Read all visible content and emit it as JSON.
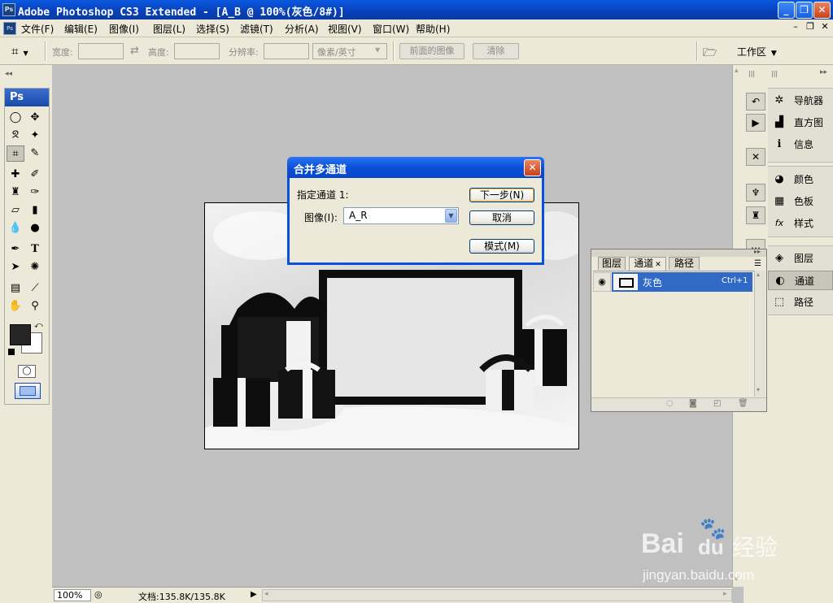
{
  "window": {
    "title": "Adobe Photoshop CS3 Extended - [A_B @ 100%(灰色/8#)]",
    "app_icon": "Ps",
    "controls": [
      "minimize-icon",
      "restore-icon",
      "close-icon"
    ]
  },
  "menubar": {
    "items": [
      "文件(F)",
      "编辑(E)",
      "图像(I)",
      "图层(L)",
      "选择(S)",
      "滤镜(T)",
      "分析(A)",
      "视图(V)",
      "窗口(W)",
      "帮助(H)"
    ]
  },
  "options": {
    "tool_icon": "crop-icon",
    "width_label": "宽度:",
    "height_label": "高度:",
    "resolution_label": "分辨率:",
    "unit_select": "像素/英寸",
    "front_image_button": "前面的图像",
    "clear_button": "清除",
    "workspace_label": "工作区",
    "width_value": "",
    "height_value": "",
    "resolution_value": ""
  },
  "toolbox": {
    "badge": "Ps"
  },
  "statusbar": {
    "zoom": "100%",
    "doc_info": "文档:135.8K/135.8K"
  },
  "dock": {
    "panels": [
      "导航器",
      "直方图",
      "信息",
      "颜色",
      "色板",
      "样式",
      "图层",
      "通道",
      "路径"
    ],
    "active_panel": "通道"
  },
  "channels_panel": {
    "tabs": [
      "图层",
      "通道",
      "路径"
    ],
    "active_tab": "通道",
    "row": {
      "name": "灰色",
      "shortcut": "Ctrl+1"
    }
  },
  "dialog": {
    "title": "合并多通道",
    "specify_label": "指定通道 1:",
    "image_label": "图像(I):",
    "image_value": "A_R",
    "buttons": {
      "next": "下一步(N)",
      "cancel": "取消",
      "mode": "模式(M)"
    }
  },
  "watermark": {
    "brand_a": "Bai",
    "brand_b": "du",
    "brand_c": "经验",
    "url": "jingyan.baidu.com"
  },
  "colors": {
    "title_blue": "#0a58e0",
    "dialog_border": "#0851d8",
    "selection": "#3169c6",
    "canvas_bg": "#c0c0c0",
    "chrome": "#ece9d8"
  }
}
